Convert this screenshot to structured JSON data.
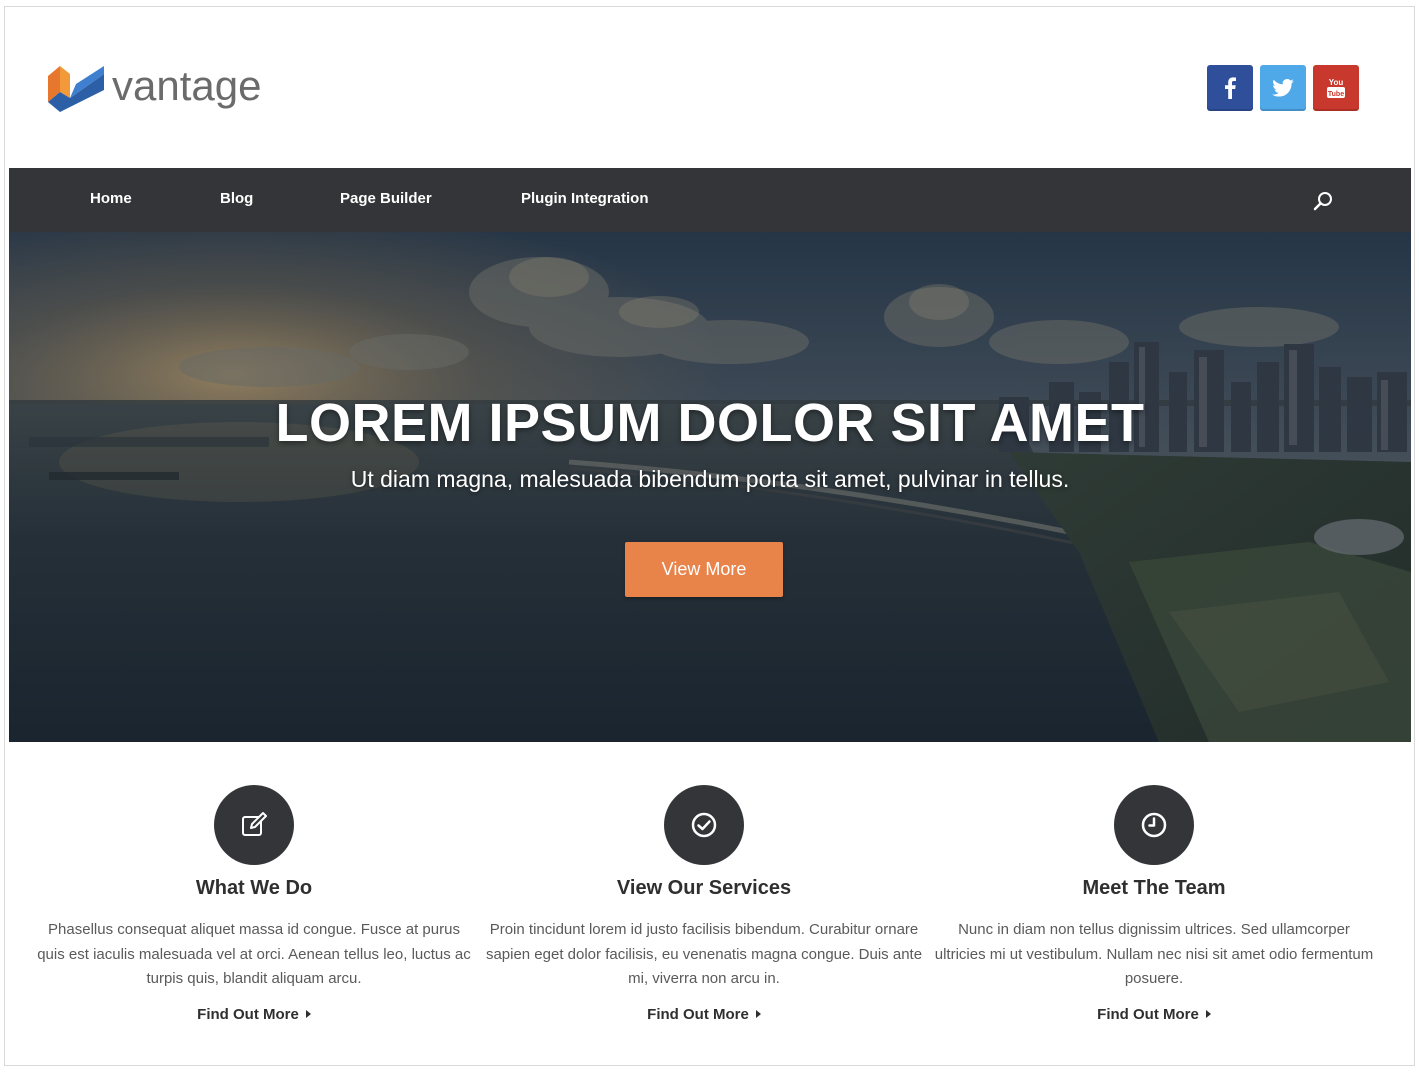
{
  "brand": {
    "name": "vantage"
  },
  "social": [
    {
      "name": "facebook",
      "icon": "facebook-icon",
      "color": "#2f4f9a"
    },
    {
      "name": "twitter",
      "icon": "twitter-icon",
      "color": "#4fa9e8"
    },
    {
      "name": "youtube",
      "icon": "youtube-icon",
      "color": "#c9382c"
    }
  ],
  "nav": {
    "items": [
      {
        "label": "Home"
      },
      {
        "label": "Blog"
      },
      {
        "label": "Page Builder"
      },
      {
        "label": "Plugin Integration"
      }
    ],
    "search_icon": "search-icon"
  },
  "hero": {
    "title": "LOREM IPSUM DOLOR SIT AMET",
    "subtitle": "Ut diam magna, malesuada bibendum porta sit amet, pulvinar in tellus.",
    "button_label": "View More",
    "button_color": "#e8834a"
  },
  "features": [
    {
      "icon": "edit-icon",
      "title": "What We Do",
      "text": "Phasellus consequat aliquet massa id congue. Fusce at purus quis est iaculis malesuada vel at orci. Aenean tellus leo, luctus ac turpis quis, blandit aliquam arcu.",
      "link": "Find Out More"
    },
    {
      "icon": "check-circle-icon",
      "title": "View Our Services",
      "text": "Proin tincidunt lorem id justo facilisis bibendum. Curabitur ornare sapien eget dolor facilisis, eu venenatis magna congue. Duis ante mi, viverra non arcu in.",
      "link": "Find Out More"
    },
    {
      "icon": "clock-icon",
      "title": "Meet The Team",
      "text": "Nunc in diam non tellus dignissim ultrices. Sed ullamcorper ultricies mi ut vestibulum. Nullam nec nisi sit amet odio fermentum posuere.",
      "link": "Find Out More"
    }
  ],
  "colors": {
    "nav_bg": "#343538",
    "accent": "#e8834a",
    "logo_orange": "#e8772e",
    "logo_blue": "#2c5fa6"
  }
}
